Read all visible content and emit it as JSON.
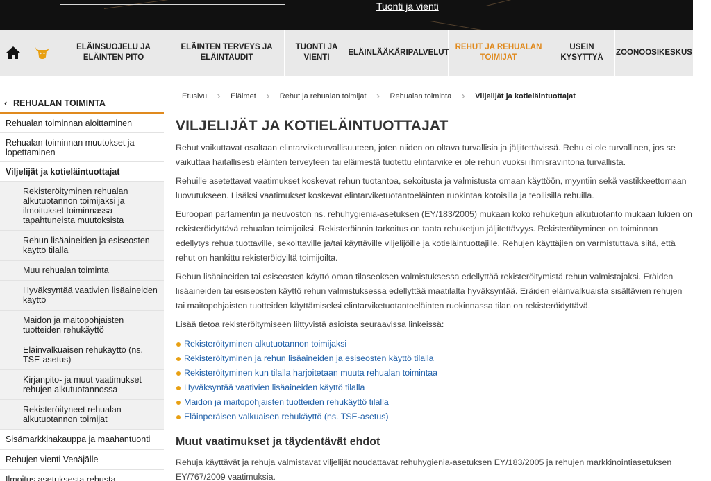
{
  "hero": {
    "link": "Tuonti ja vienti"
  },
  "nav": {
    "items": [
      {
        "label": "ELÄINSUOJELU JA ELÄINTEN PITO"
      },
      {
        "label": "ELÄINTEN TERVEYS JA ELÄINTAUDIT"
      },
      {
        "label": "TUONTI JA VIENTI"
      },
      {
        "label": "ELÄINLÄÄKÄRIPALVELUT"
      },
      {
        "label": "REHUT JA REHUALAN TOIMIJAT"
      },
      {
        "label": "USEIN KYSYTTYÄ"
      },
      {
        "label": "ZOONOOSIKESKUS"
      }
    ]
  },
  "sidebar": {
    "back": "REHUALAN TOIMINTA",
    "items": [
      {
        "label": "Rehualan toiminnan aloittaminen"
      },
      {
        "label": "Rehualan toiminnan muutokset ja lopettaminen"
      },
      {
        "label": "Viljelijät ja kotieläintuottajat"
      },
      {
        "label": "Rekisteröityminen rehualan alkutuotannon toimijaksi ja ilmoitukset toiminnassa tapahtuneista muutoksista"
      },
      {
        "label": "Rehun lisäaineiden ja esiseosten käyttö tilalla"
      },
      {
        "label": "Muu rehualan toiminta"
      },
      {
        "label": "Hyväksyntää vaativien lisäaineiden käyttö"
      },
      {
        "label": "Maidon ja maitopohjaisten tuotteiden rehukäyttö"
      },
      {
        "label": "Eläinvalkuaisen rehukäyttö (ns. TSE-asetus)"
      },
      {
        "label": "Kirjanpito- ja muut vaatimukset rehujen alkutuotannossa"
      },
      {
        "label": "Rekisteröityneet rehualan alkutuotannon toimijat"
      },
      {
        "label": "Sisämarkkinakauppa ja maahantuonti"
      },
      {
        "label": "Rehujen vienti Venäjälle"
      },
      {
        "label": "Ilmoitus asetuksesta rehusta"
      }
    ]
  },
  "breadcrumb": [
    "Etusivu",
    "Eläimet",
    "Rehut ja rehualan toimijat",
    "Rehualan toiminta",
    "Viljelijät ja kotieläintuottajat"
  ],
  "main": {
    "title": "VILJELIJÄT JA KOTIELÄINTUOTTAJAT",
    "p1": "Rehut vaikuttavat osaltaan elintarviketurvallisuuteen, joten niiden on oltava turvallisia ja jäljitettävissä. Rehu ei ole turvallinen, jos se vaikuttaa haitallisesti eläinten terveyteen tai eläimestä tuotettu elintarvike ei ole rehun vuoksi ihmisravintona turvallista.",
    "p2": "Rehuille asetettavat vaatimukset koskevat rehun tuotantoa, sekoitusta ja valmistusta omaan käyttöön, myyntiin sekä vastikkeettomaan luovutukseen. Lisäksi vaatimukset koskevat elintarviketuotantoeläinten ruokintaa kotoisilla ja teollisilla rehuilla.",
    "p3": "Euroopan parlamentin ja neuvoston ns. rehuhygienia-asetuksen (EY/183/2005) mukaan koko rehuketjun alkutuotanto mukaan lukien on rekisteröidyttävä rehualan toimijoiksi. Rekisteröinnin tarkoitus on taata rehuketjun jäljitettävyys. Rekisteröityminen on toiminnan edellytys rehua tuottaville, sekoittaville ja/tai käyttäville viljelijöille ja kotieläintuottajille. Rehujen käyttäjien on varmistuttava siitä, että rehut on hankittu rekisteröidyiltä toimijoilta.",
    "p4": "Rehun lisäaineiden tai esiseosten käyttö oman tilaseoksen valmistuksessa edellyttää rekisteröitymistä rehun valmistajaksi. Eräiden lisäaineiden tai esiseosten käyttö rehun valmistuksessa edellyttää maatilalta hyväksyntää. Eräiden eläinvalkuaista sisältävien rehujen tai maitopohjaisten tuotteiden käyttämiseksi elintarviketuotantoeläinten ruokinnassa tilan on rekisteröidyttävä.",
    "p5": "Lisää tietoa rekisteröitymiseen liittyvistä asioista seuraavissa linkeissä:",
    "links": [
      "Rekisteröityminen alkutuotannon toimijaksi",
      "Rekisteröityminen ja rehun lisäaineiden ja esiseosten käyttö tilalla",
      "Rekisteröityminen kun tilalla harjoitetaan muuta rehualan toimintaa",
      "Hyväksyntää vaativien lisäaineiden käyttö tilalla",
      "Maidon ja maitopohjaisten tuotteiden rehukäyttö tilalla",
      "Eläinperäisen valkuaisen rehukäyttö (ns. TSE-asetus)"
    ],
    "h2": "Muut vaatimukset ja täydentävät ehdot",
    "p6": "Rehuja käyttävät ja rehuja valmistavat viljelijät noudattavat rehuhygienia-asetuksen EY/183/2005 ja rehujen markkinointiasetuksen EY/767/2009 vaatimuksia."
  },
  "colors": {
    "accent": "#e08a1e",
    "link": "#1f5fa8",
    "bullet": "#e8a013"
  }
}
